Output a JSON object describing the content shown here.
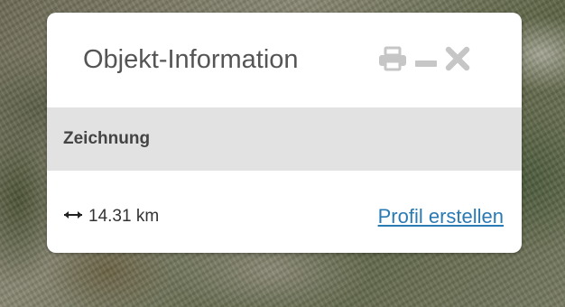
{
  "popup": {
    "title": "Objekt-Information",
    "icons": [
      "print-icon",
      "minimize-icon",
      "close-icon"
    ]
  },
  "section": {
    "title": "Zeichnung"
  },
  "measurement": {
    "icon": "horizontal-arrow-icon",
    "distance": "14.31 km"
  },
  "actions": {
    "profile_link": "Profil erstellen"
  },
  "colors": {
    "link": "#2a7ab4",
    "section_bg": "#e2e2e2",
    "icon_gray": "#c6c6c6"
  }
}
